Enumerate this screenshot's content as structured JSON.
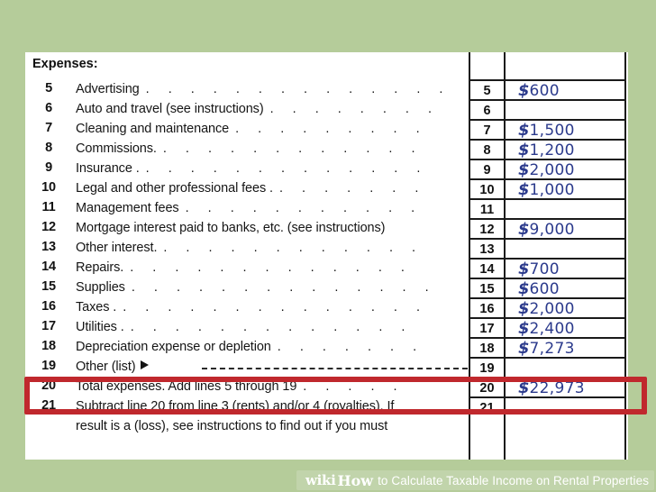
{
  "colors": {
    "page_background": "#b5cc9a",
    "form_background": "#ffffff",
    "rule": "#1a1a1a",
    "ink_blue": "#2b3a8c",
    "highlight_red": "#c0282d",
    "watermark_text": "#ffffff"
  },
  "form": {
    "section_header": "Expenses:"
  },
  "watermark": {
    "brand_wiki": "wiki",
    "brand_how": "How",
    "tail": "to Calculate Taxable Income on Rental Properties"
  },
  "rows": [
    {
      "line": "5",
      "description": "Advertising",
      "leader": ". . . . . . . . . . . . . .",
      "amount_symbol": "$",
      "amount_digits": "600"
    },
    {
      "line": "6",
      "description": "Auto and travel (see instructions)",
      "leader": ". . . . . . . .",
      "amount_symbol": "",
      "amount_digits": ""
    },
    {
      "line": "7",
      "description": "Cleaning and maintenance",
      "leader": ". . . . . . . . .",
      "amount_symbol": "$",
      "amount_digits": "1,500"
    },
    {
      "line": "8",
      "description": "Commissions.",
      "leader": ". . . . . . . . . . . .",
      "amount_symbol": "$",
      "amount_digits": "1,200"
    },
    {
      "line": "9",
      "description": "Insurance .",
      "leader": ". . . . . . . . . . . . .",
      "amount_symbol": "$",
      "amount_digits": "2,000"
    },
    {
      "line": "10",
      "description": "Legal and other professional fees .",
      "leader": ". . . . . . .",
      "amount_symbol": "$",
      "amount_digits": "1,000"
    },
    {
      "line": "11",
      "description": "Management fees",
      "leader": ". . . . . . . . . . .",
      "amount_symbol": "",
      "amount_digits": ""
    },
    {
      "line": "12",
      "description": "Mortgage interest paid to banks, etc. (see instructions)",
      "leader": "",
      "amount_symbol": "$",
      "amount_digits": "9,000"
    },
    {
      "line": "13",
      "description": "Other interest.",
      "leader": ". . . . . . . . . . . .",
      "amount_symbol": "",
      "amount_digits": ""
    },
    {
      "line": "14",
      "description": "Repairs.",
      "leader": ". . . . . . . . . . . . .",
      "amount_symbol": "$",
      "amount_digits": "700"
    },
    {
      "line": "15",
      "description": "Supplies",
      "leader": ". . . . . . . . . . . . . .",
      "amount_symbol": "$",
      "amount_digits": "600"
    },
    {
      "line": "16",
      "description": "Taxes .",
      "leader": ". . . . . . . . . . . . . .",
      "amount_symbol": "$",
      "amount_digits": "2,000"
    },
    {
      "line": "17",
      "description": "Utilities .",
      "leader": ". . . . . . . . . . . . .",
      "amount_symbol": "$",
      "amount_digits": "2,400"
    },
    {
      "line": "18",
      "description": "Depreciation expense or depletion",
      "leader": ". . . . . . .",
      "amount_symbol": "$",
      "amount_digits": "7,273"
    },
    {
      "line": "19",
      "description": "Other (list)",
      "leader": "",
      "amount_symbol": "",
      "amount_digits": "",
      "has_pointer": true,
      "has_dashline": true
    },
    {
      "line": "20",
      "description": "Total expenses. Add lines 5 through 19",
      "leader": ". . . . .",
      "amount_symbol": "$",
      "amount_digits": "22,973",
      "highlighted": true
    },
    {
      "line": "21",
      "description": "Subtract line 20 from line 3 (rents) and/or 4 (royalties). If",
      "leader": "",
      "amount_symbol": "",
      "amount_digits": ""
    },
    {
      "line": "",
      "description": "result is a (loss), see instructions to find out if you must",
      "leader": "",
      "amount_symbol": "",
      "amount_digits": ""
    }
  ]
}
